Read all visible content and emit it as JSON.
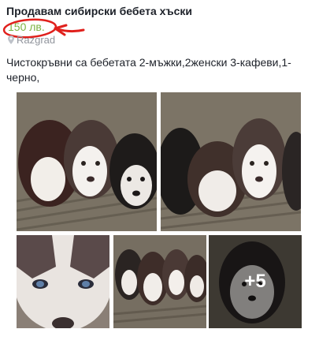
{
  "listing": {
    "title": "Продавам сибирски бебета хъски",
    "price": "150 лв.",
    "location": "Razgrad",
    "description": "Чистокръвни са бебетата 2-мъжки,2женски 3-кафеви,1-черно,"
  },
  "gallery": {
    "more_count": "+5"
  },
  "colors": {
    "price": "#7cb342",
    "annotation": "#e0201c",
    "muted": "#90949c"
  }
}
